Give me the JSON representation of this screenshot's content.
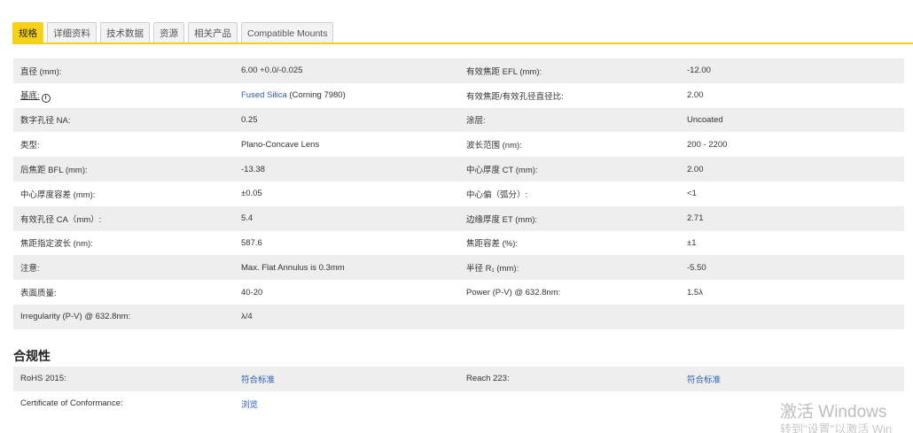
{
  "tabs": [
    {
      "label": "规格",
      "active": true
    },
    {
      "label": "详细资料",
      "active": false
    },
    {
      "label": "技术数据",
      "active": false
    },
    {
      "label": "资源",
      "active": false
    },
    {
      "label": "相关产品",
      "active": false
    },
    {
      "label": "Compatible Mounts",
      "active": false
    }
  ],
  "specs": [
    {
      "l1": "直径 (mm):",
      "v1": "6.00 +0.0/-0.025",
      "l2": "有效焦距 EFL (mm):",
      "v2": "-12.00"
    },
    {
      "l1": "基底:",
      "v1_link": "Fused Silica",
      "v1_rest": " (Corning 7980)",
      "l2": "有效焦距/有效孔径直径比:",
      "v2": "2.00"
    },
    {
      "l1": "数字孔径 NA:",
      "v1": "0.25",
      "l2": "涂层:",
      "v2": "Uncoated"
    },
    {
      "l1": "类型:",
      "v1": "Plano-Concave Lens",
      "l2": "波长范围 (nm):",
      "v2": "200 - 2200"
    },
    {
      "l1": "后焦距 BFL (mm):",
      "v1": "-13.38",
      "l2": "中心厚度 CT (mm):",
      "v2": "2.00"
    },
    {
      "l1": "中心厚度容差 (mm):",
      "v1": "±0.05",
      "l2": "中心偏（弧分）:",
      "v2": "<1"
    },
    {
      "l1": "有效孔径 CA（mm）:",
      "v1": "5.4",
      "l2": "边缘厚度 ET (mm):",
      "v2": "2.71"
    },
    {
      "l1": "焦距指定波长 (nm):",
      "v1": "587.6",
      "l2": "焦距容差 (%):",
      "v2": "±1"
    },
    {
      "l1": "注意:",
      "v1": "Max. Flat Annulus is 0.3mm",
      "l2": "半径 R₁ (mm):",
      "v2": "-5.50"
    },
    {
      "l1": "表面质量:",
      "v1": "40-20",
      "l2": "Power (P-V) @ 632.8nm:",
      "v2": "1.5λ"
    },
    {
      "l1": "Irregularity (P-V) @ 632.8nm:",
      "v1": "λ/4",
      "l2": "",
      "v2": ""
    }
  ],
  "compliance": {
    "title": "合规性",
    "rows": [
      {
        "l1": "RoHS 2015:",
        "v1": "符合标准",
        "l2": "Reach 223:",
        "v2": "符合标准"
      },
      {
        "l1": "Certificate of Conformance:",
        "v1": "浏览",
        "l2": "",
        "v2": ""
      }
    ]
  },
  "watermark": {
    "line1": "激活 Windows",
    "line2": "转到\"设置\"以激活 Win"
  },
  "colors": {
    "accent": "#f7d117",
    "link": "#2a5db0",
    "row_shade": "#eeeeee"
  }
}
